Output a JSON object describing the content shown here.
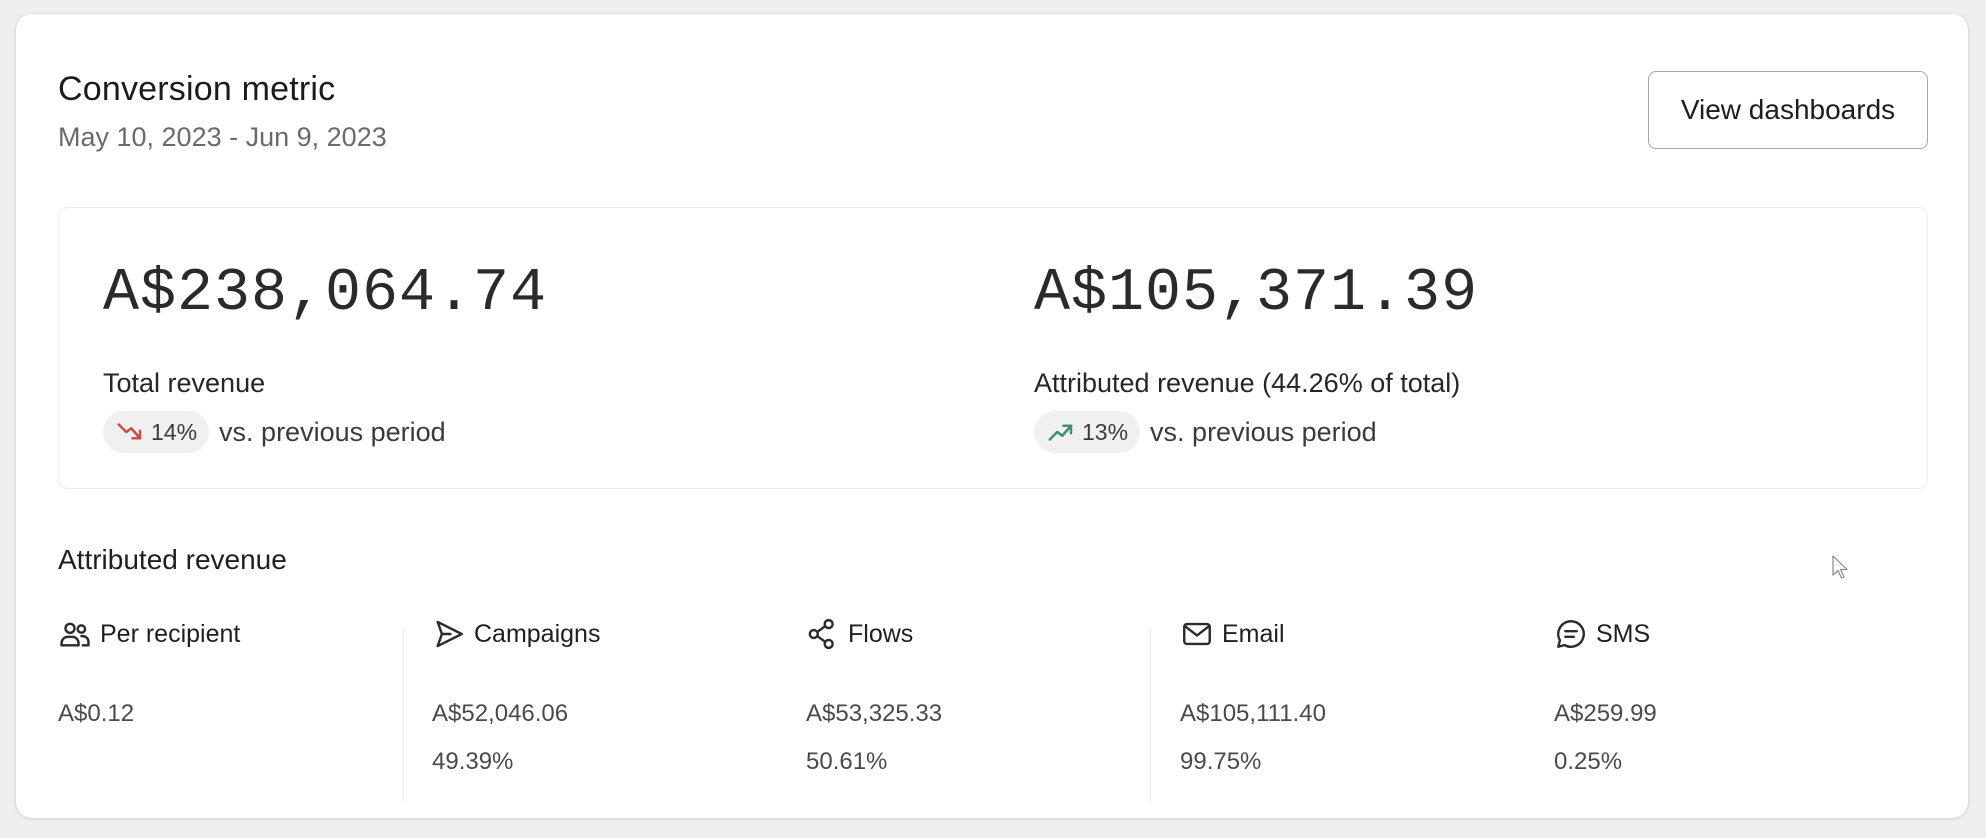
{
  "header": {
    "title": "Conversion metric",
    "date_range": "May 10, 2023 - Jun 9, 2023",
    "view_button_label": "View dashboards"
  },
  "summary": {
    "total": {
      "value": "A$238,064.74",
      "label": "Total revenue",
      "change": "14%",
      "direction": "down",
      "comparison": "vs. previous period"
    },
    "attributed": {
      "value": "A$105,371.39",
      "label": "Attributed revenue (44.26% of total)",
      "change": "13%",
      "direction": "up",
      "comparison": "vs. previous period"
    }
  },
  "breakdown": {
    "title": "Attributed revenue",
    "channels": [
      {
        "icon": "people-icon",
        "label": "Per recipient",
        "amount": "A$0.12",
        "percent": ""
      },
      {
        "icon": "send-icon",
        "label": "Campaigns",
        "amount": "A$52,046.06",
        "percent": "49.39%"
      },
      {
        "icon": "flows-icon",
        "label": "Flows",
        "amount": "A$53,325.33",
        "percent": "50.61%"
      },
      {
        "icon": "mail-icon",
        "label": "Email",
        "amount": "A$105,111.40",
        "percent": "99.75%"
      },
      {
        "icon": "sms-icon",
        "label": "SMS",
        "amount": "A$259.99",
        "percent": "0.25%"
      }
    ]
  },
  "colors": {
    "trend_down": "#c0504d",
    "trend_up": "#3a8f78",
    "card_bg": "#ffffff",
    "page_bg": "#eef0ef"
  }
}
